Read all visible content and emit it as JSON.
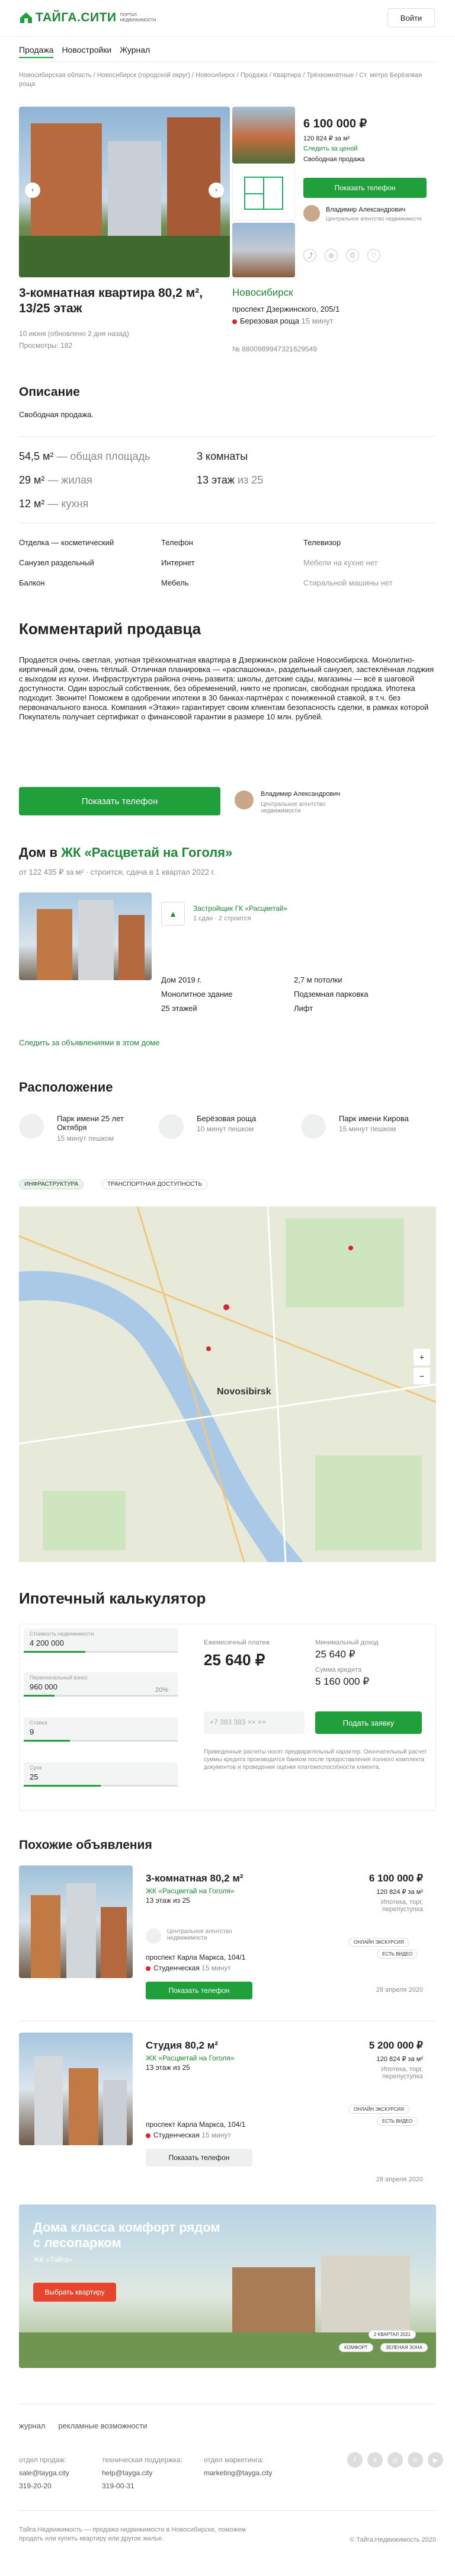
{
  "header": {
    "logo": "ТАЙГА.СИТИ",
    "logo_sub": "ПОРТАЛ НЕДВИЖИМОСТИ",
    "login": "Войти"
  },
  "nav": [
    "Продажа",
    "Новостройки",
    "Журнал"
  ],
  "breadcrumb": "Новосибирская область / Новосибирск (городской округ) / Новосибирск / Продажа / Квартира / Трёхкомнатные / Ст. метро Берёзовая роща",
  "offer": {
    "price": "6 100 000 ₽",
    "price_m2": "120 824 ₽ за м²",
    "watch_price": "Следить за ценой",
    "sale_type": "Свободная продажа",
    "show_phone": "Показать телефон",
    "agent_name": "Владимир Александрович",
    "agent_org": "Центральное агентство недвижимости",
    "title": "3-комнатная квартира 80,2 м², 13/25 этаж",
    "date": "10 июня (обновлено 2 дня назад)",
    "views": "Просмотры: 182",
    "city": "Новосибирск",
    "address": "проспект Дзержинского, 205/1",
    "metro": "Березовая роща",
    "metro_time": "15 минут",
    "id": "№ 8800989947321629549"
  },
  "desc": {
    "title": "Описание",
    "text": "Свободная продажа."
  },
  "params": {
    "area": "54,5 м²",
    "area_lbl": "— общая площадь",
    "living": "29 м²",
    "living_lbl": "— жилая",
    "kitchen": "12 м²",
    "kitchen_lbl": "— кухня",
    "rooms": "3 комнаты",
    "floor": "13 этаж",
    "floor_of": "из 25"
  },
  "features": [
    [
      "Отделка — косметический",
      "Телефон",
      "Телевизор"
    ],
    [
      "Санузел раздельный",
      "Интернет",
      "Мебели на кухне нет"
    ],
    [
      "Балкон",
      "Мебель",
      "Стиральной машины нет"
    ]
  ],
  "comment": {
    "title": "Комментарий продавца",
    "text": "Продается очень светлая, уютная трёхкомнатная квартира в Дзержинском районе Новосибирска. Монолитно-кирпичный дом, очень тёплый. Отличная планировка — «распашонка», раздельный санузел, застеклённая лоджия с выходом из кухни. Инфраструктура района очень развита: школы, детские сады, магазины — всё в шаговой доступности. Один взрослый собственник, без обременений, никто не прописан, свободная продажа. Ипотека подходит. Звоните! Поможем в одобрении ипотеки в 30 банках-партнёрах с пониженной ставкой, в т.ч. без первоначального взноса. Компания «Этажи» гарантирует своим клиентам безопасность сделки, в рамках которой Покупатель получает сертификат о финансовой гарантии в размере 10 млн. рублей.",
    "btn": "Показать телефон"
  },
  "house": {
    "title_pre": "Дом в ",
    "title_link": "ЖК «Расцветай на Гоголя»",
    "sub_price": "от 122 435 ₽ за м²",
    "sub_text": " · строится, сдача в 1 квартал 2022 г.",
    "dev": "Застройщик ГК «Расцветай»",
    "dev_sub": "1 сдан · 2 строится",
    "facts": [
      "Дом 2019 г.",
      "Монолитное здание",
      "25 этажей",
      "2,7 м потолки",
      "Подземная парковка",
      "Лифт"
    ],
    "follow": "Следить за объявлениями в этом доме"
  },
  "location": {
    "title": "Расположение",
    "items": [
      {
        "name": "Парк имени 25 лет Октября",
        "time": "15 минут пешком"
      },
      {
        "name": "Берёзовая роща",
        "time": "10 минут пешком"
      },
      {
        "name": "Парк имени Кирова",
        "time": "15 минут пешком"
      }
    ],
    "tabs": [
      "ИНФРАСТРУКТУРА",
      "ТРАНСПОРТНАЯ ДОСТУПНОСТЬ"
    ],
    "map_city": "Novosibirsk"
  },
  "calc": {
    "title": "Ипотечный калькулятор",
    "cost_lbl": "Стоимость недвижимости",
    "cost": "4 200 000",
    "first_lbl": "Первоначальный взнос",
    "first": "960 000",
    "first_pct": "20%",
    "rate_lbl": "Ставка",
    "rate": "9",
    "term_lbl": "Срок",
    "term": "25",
    "pay_lbl": "Ежемесячный платеж",
    "pay": "25 640 ₽",
    "min_lbl": "Минимальный доход",
    "min": "25 640 ₽",
    "sum_lbl": "Сумма кредита",
    "sum": "5 160 000 ₽",
    "phone_ph": "+7 383 383 ×× ××",
    "apply": "Подать заявку",
    "note": "Приведенные расчеты носят предварительный характер. Окончательный расчет суммы кредита производится банком после предоставления полного комплекта документов и проведения оценки платежеспособности клиента."
  },
  "similar": {
    "title": "Похожие объявления",
    "items": [
      {
        "title": "3-комнатная 80,2 м²",
        "jk": "ЖК «Расцветай на Гоголя»",
        "floor": "13 этаж из 25",
        "agency": "Центральное агентство недвижимости",
        "address": "проспект Карла Маркса, 104/1",
        "metro": "Студенческая",
        "metro_time": "15 минут",
        "btn": "Показать телефон",
        "price": "6 100 000 ₽",
        "m2": "120 824 ₽ за м²",
        "cond": "Ипотека, торг, перепуступка",
        "b1": "ОНЛАЙН ЭКСКУРСИЯ",
        "b2": "ЕСТЬ ВИДЕО",
        "date": "28 апреля 2020"
      },
      {
        "title": "Студия 80,2 м²",
        "jk": "ЖК «Расцветай на Гоголя»",
        "floor": "13 этаж из 25",
        "address": "проспект Карла Маркса, 104/1",
        "metro": "Студенческая",
        "metro_time": "15 минут",
        "btn": "Показать телефон",
        "price": "5 200 000 ₽",
        "m2": "120 824 ₽ за м²",
        "cond": "Ипотека, торг, перепуступка",
        "b1": "ОНЛАЙН ЭКСКУРСИЯ",
        "b2": "ЕСТЬ ВИДЕО",
        "date": "28 апреля 2020"
      }
    ]
  },
  "promo": {
    "title": "Дома класса комфорт рядом с лесопарком",
    "sub": "ЖК «Тайга»",
    "btn": "Выбрать квартиру",
    "tag1": "2 КВАРТАЛ 2021",
    "tag2": "КОМФОРТ",
    "tag3": "ЗЕЛЕНАЯ ЗОНА"
  },
  "footer": {
    "links": [
      "журнал",
      "рекламные возможности"
    ],
    "cols": [
      {
        "h": "отдел продаж:",
        "e": "sale@tayga.city",
        "p": "319-20-20"
      },
      {
        "h": "техническая поддержка:",
        "e": "help@tayga.city",
        "p": "319-00-31"
      },
      {
        "h": "отдел маркетинга:",
        "e": "marketing@tayga.city",
        "p": ""
      }
    ],
    "copy": "Тайга.Недвижимость — продажа недвижимости в Новосибирске, поможем продать или купить квартиру или другое жилье.",
    "rights": "© Тайга.Недвижимость 2020"
  },
  "colors": {
    "accent": "#20a03a",
    "link": "#1a8a35",
    "metro": "#d9262b"
  }
}
